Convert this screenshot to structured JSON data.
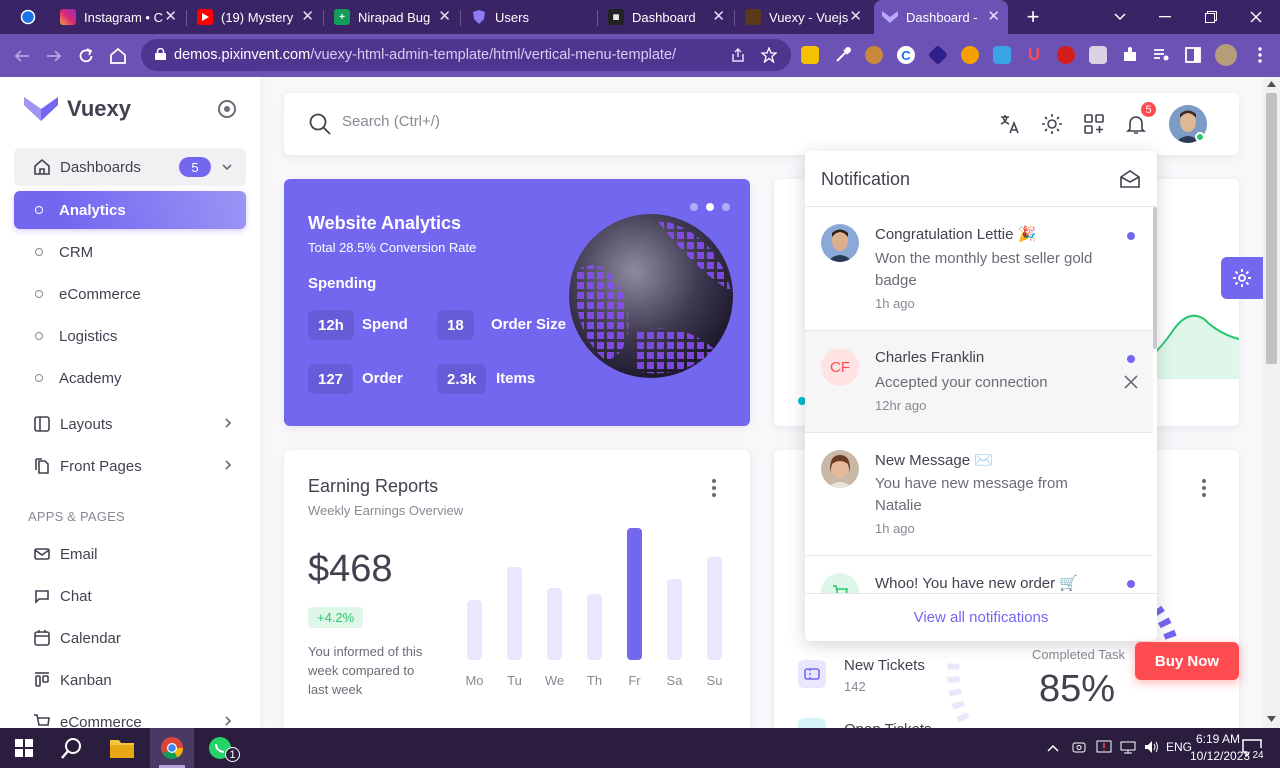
{
  "browser": {
    "tabs": [
      {
        "label": "Instagram • C",
        "active": false
      },
      {
        "label": "(19) Mystery",
        "active": false
      },
      {
        "label": "Nirapad Bug",
        "active": false
      },
      {
        "label": "Users",
        "active": false
      },
      {
        "label": "Dashboard",
        "active": false
      },
      {
        "label": "Vuexy - Vuejs",
        "active": false
      },
      {
        "label": "Dashboard -",
        "active": true
      }
    ],
    "url_host": "demos.pixinvent.com",
    "url_path": "/vuexy-html-admin-template/html/vertical-menu-template/"
  },
  "sidebar": {
    "brand": "Vuexy",
    "dashboards": {
      "label": "Dashboards",
      "badge": "5"
    },
    "sub_items": [
      "Analytics",
      "CRM",
      "eCommerce",
      "Logistics",
      "Academy"
    ],
    "layouts": "Layouts",
    "front_pages": "Front Pages",
    "section_header": "APPS & PAGES",
    "apps": [
      "Email",
      "Chat",
      "Calendar",
      "Kanban",
      "eCommerce"
    ]
  },
  "navbar": {
    "search_placeholder": "Search (Ctrl+/)",
    "notification_count": "5"
  },
  "analytics_card": {
    "title": "Website Analytics",
    "subtitle": "Total 28.5% Conversion Rate",
    "section": "Spending",
    "stats": [
      {
        "value": "12h",
        "label": "Spend"
      },
      {
        "value": "18",
        "label": "Order Size"
      },
      {
        "value": "127",
        "label": "Order"
      },
      {
        "value": "2.3k",
        "label": "Items"
      }
    ]
  },
  "earning_card": {
    "title": "Earning Reports",
    "subtitle": "Weekly Earnings Overview",
    "amount": "$468",
    "change": "+4.2%",
    "note": "You informed of this week compared to last week"
  },
  "chart_data": {
    "type": "bar",
    "categories": [
      "Mo",
      "Tu",
      "We",
      "Th",
      "Fr",
      "Sa",
      "Su"
    ],
    "values": [
      40,
      62,
      48,
      44,
      88,
      54,
      69
    ],
    "highlight_index": 4,
    "title": "",
    "xlabel": "",
    "ylabel": ""
  },
  "support_card": {
    "ticket_label": "New Tickets",
    "ticket_value": "142",
    "open_label": "Open Tickets",
    "completed_label": "Completed Task",
    "completed_value": "85%"
  },
  "notifications": {
    "title": "Notification",
    "items": [
      {
        "title": "Congratulation Lettie 🎉",
        "text": "Won the monthly best seller gold badge",
        "time": "1h ago"
      },
      {
        "initials": "CF",
        "title": "Charles Franklin",
        "text": "Accepted your connection",
        "time": "12hr ago"
      },
      {
        "title": "New Message ✉️",
        "text": "You have new message from Natalie",
        "time": "1h ago"
      },
      {
        "title": "Whoo! You have new order 🛒",
        "text": "",
        "time": ""
      }
    ],
    "footer": "View all notifications"
  },
  "buy_now": "Buy Now",
  "taskbar": {
    "time": "6:19 AM",
    "date": "10/12/2023",
    "notif_count": "24",
    "whatsapp_badge": "1"
  },
  "colors": {
    "primary": "#7367f0",
    "success": "#28c76f",
    "danger": "#ff4c51",
    "chrome": "#6d52b5"
  }
}
